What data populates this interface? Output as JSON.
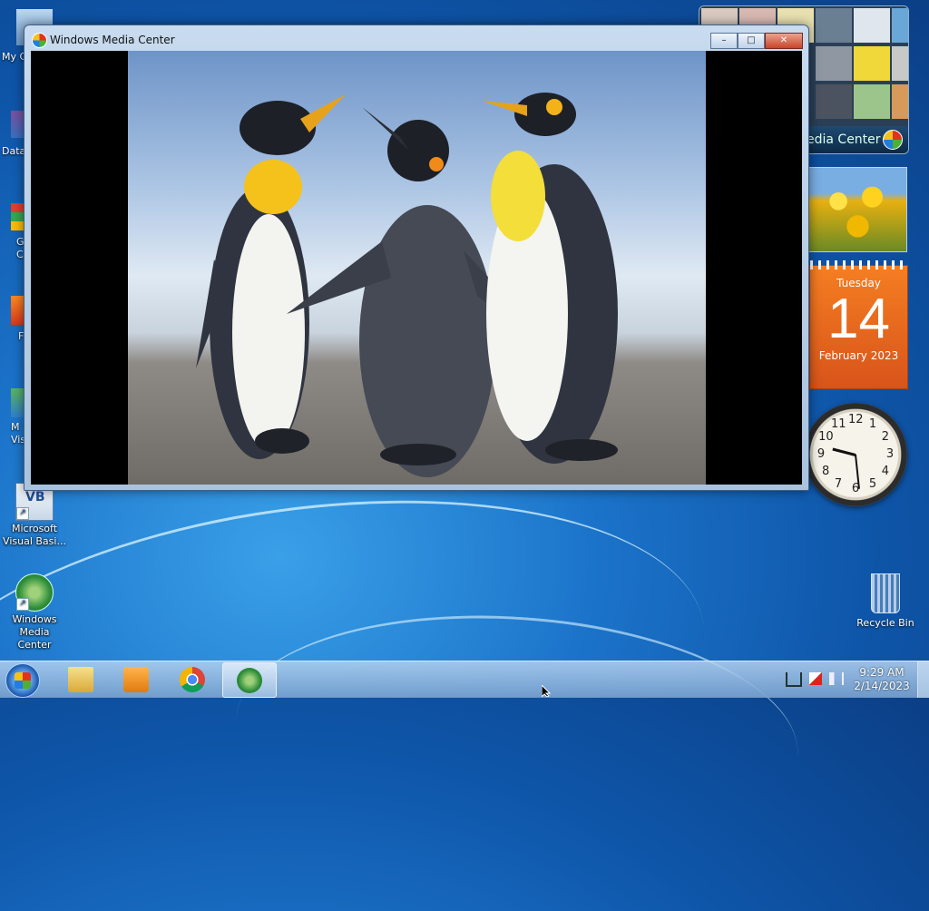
{
  "desktop": {
    "icons": [
      {
        "label": "My C",
        "icon": "computer-icon"
      },
      {
        "label": "Data",
        "icon": "database-icon"
      },
      {
        "label": "G\nC",
        "icon": "chrome-icon"
      },
      {
        "label": "F",
        "icon": "firefox-icon"
      },
      {
        "label": "M\nVis",
        "icon": "visual-studio-icon"
      },
      {
        "label": "Microsoft Visual Basi...",
        "icon": "visual-basic-icon"
      },
      {
        "label": "Windows Media Center",
        "icon": "windows-media-center-icon"
      }
    ],
    "recycle_bin": "Recycle Bin",
    "vb_badge": "VB"
  },
  "window": {
    "title": "Windows Media Center",
    "minimize": "–",
    "maximize": "□",
    "close": "✕",
    "content": "penguins-photo"
  },
  "gadgets": {
    "media_center": {
      "label": "edia Center"
    },
    "calendar": {
      "weekday": "Tuesday",
      "day": "14",
      "month_year": "February 2023"
    },
    "clock": {
      "time": "9:29",
      "numbers": [
        "12",
        "1",
        "2",
        "3",
        "4",
        "5",
        "6",
        "7",
        "8",
        "9",
        "10",
        "11"
      ]
    }
  },
  "taskbar": {
    "apps": [
      {
        "name": "file-explorer",
        "active": false
      },
      {
        "name": "windows-media-player",
        "active": false
      },
      {
        "name": "google-chrome",
        "active": false
      },
      {
        "name": "windows-media-center",
        "active": true
      }
    ],
    "tray_icons": [
      "network-icon",
      "action-center-flag-icon",
      "volume-icon"
    ],
    "time": "9:29 AM",
    "date": "2/14/2023"
  },
  "colors": {
    "accent": "#1b73c9",
    "calendar": "#e8651e"
  }
}
